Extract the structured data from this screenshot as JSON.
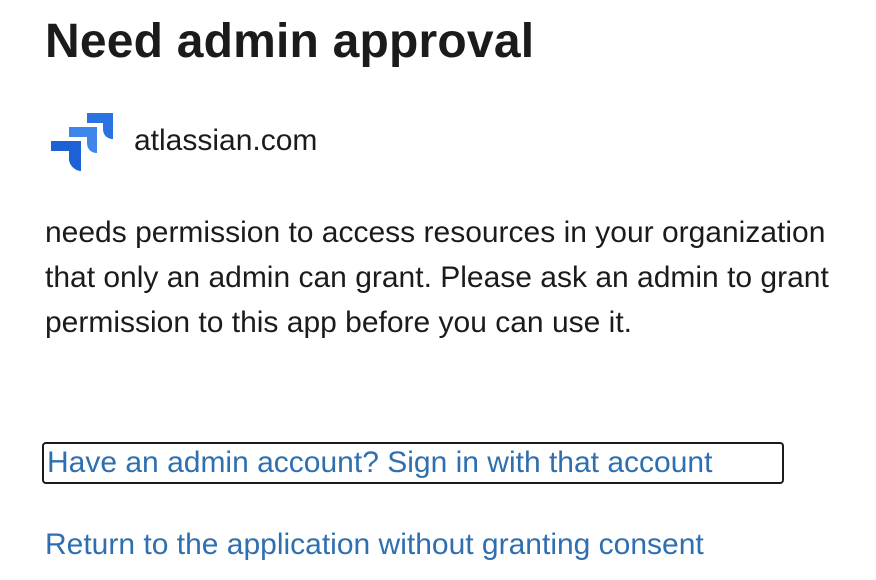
{
  "dialog": {
    "title": "Need admin approval",
    "app": {
      "name": "atlassian.com",
      "logo_icon": "jira-logo-icon"
    },
    "description": "needs permission to access resources in your organization that only an admin can grant. Please ask an admin to grant permission to this app before you can use it.",
    "links": {
      "admin_signin": "Have an admin account? Sign in with that account",
      "return_without_consent": "Return to the application without granting consent"
    }
  },
  "colors": {
    "text": "#1b1b1b",
    "link": "#2f6fb0",
    "logo_light": "#4a8fe7",
    "logo_dark": "#1c5fd1"
  }
}
